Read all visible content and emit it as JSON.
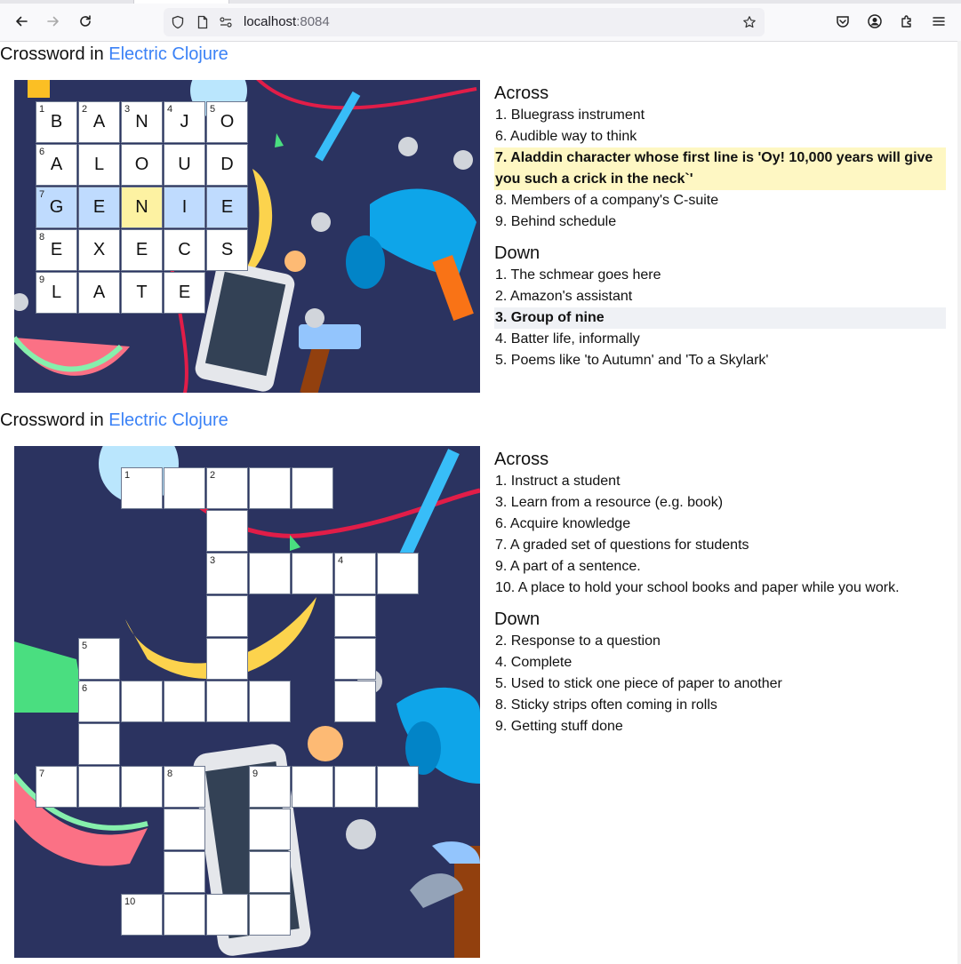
{
  "browser": {
    "url_host": "localhost",
    "url_port": ":8084"
  },
  "crossword1": {
    "title_prefix": "Crossword in ",
    "title_link": "Electric Clojure",
    "across_heading": "Across",
    "down_heading": "Down",
    "across": [
      {
        "text": "1. Bluegrass instrument",
        "state": ""
      },
      {
        "text": "6. Audible way to think",
        "state": ""
      },
      {
        "text": "7. Aladdin character whose first line is 'Oy! 10,000 years will give you such a crick in the neck`'",
        "state": "active"
      },
      {
        "text": "8. Members of a company's C-suite",
        "state": ""
      },
      {
        "text": "9. Behind schedule",
        "state": ""
      }
    ],
    "down": [
      {
        "text": "1. The schmear goes here",
        "state": ""
      },
      {
        "text": "2. Amazon's assistant",
        "state": ""
      },
      {
        "text": "3. Group of nine",
        "state": "secondary"
      },
      {
        "text": "4. Batter life, informally",
        "state": ""
      },
      {
        "text": "5. Poems like 'to Autumn' and 'To a Skylark'",
        "state": ""
      }
    ],
    "cells": [
      {
        "r": 0,
        "c": 0,
        "n": "1",
        "l": "B"
      },
      {
        "r": 0,
        "c": 1,
        "n": "2",
        "l": "A"
      },
      {
        "r": 0,
        "c": 2,
        "n": "3",
        "l": "N"
      },
      {
        "r": 0,
        "c": 3,
        "n": "4",
        "l": "J"
      },
      {
        "r": 0,
        "c": 4,
        "n": "5",
        "l": "O"
      },
      {
        "r": 1,
        "c": 0,
        "n": "6",
        "l": "A"
      },
      {
        "r": 1,
        "c": 1,
        "n": "",
        "l": "L"
      },
      {
        "r": 1,
        "c": 2,
        "n": "",
        "l": "O"
      },
      {
        "r": 1,
        "c": 3,
        "n": "",
        "l": "U"
      },
      {
        "r": 1,
        "c": 4,
        "n": "",
        "l": "D"
      },
      {
        "r": 2,
        "c": 0,
        "n": "7",
        "l": "G",
        "s": "hl"
      },
      {
        "r": 2,
        "c": 1,
        "n": "",
        "l": "E",
        "s": "hl"
      },
      {
        "r": 2,
        "c": 2,
        "n": "",
        "l": "N",
        "s": "cur"
      },
      {
        "r": 2,
        "c": 3,
        "n": "",
        "l": "I",
        "s": "hl"
      },
      {
        "r": 2,
        "c": 4,
        "n": "",
        "l": "E",
        "s": "hl"
      },
      {
        "r": 3,
        "c": 0,
        "n": "8",
        "l": "E"
      },
      {
        "r": 3,
        "c": 1,
        "n": "",
        "l": "X"
      },
      {
        "r": 3,
        "c": 2,
        "n": "",
        "l": "E"
      },
      {
        "r": 3,
        "c": 3,
        "n": "",
        "l": "C"
      },
      {
        "r": 3,
        "c": 4,
        "n": "",
        "l": "S"
      },
      {
        "r": 4,
        "c": 0,
        "n": "9",
        "l": "L"
      },
      {
        "r": 4,
        "c": 1,
        "n": "",
        "l": "A"
      },
      {
        "r": 4,
        "c": 2,
        "n": "",
        "l": "T"
      },
      {
        "r": 4,
        "c": 3,
        "n": "",
        "l": "E"
      }
    ]
  },
  "crossword2": {
    "title_prefix": "Crossword in ",
    "title_link": "Electric Clojure",
    "across_heading": "Across",
    "down_heading": "Down",
    "across": [
      {
        "text": "1. Instruct a student",
        "state": ""
      },
      {
        "text": "3. Learn from a resource (e.g. book)",
        "state": ""
      },
      {
        "text": "6. Acquire knowledge",
        "state": ""
      },
      {
        "text": "7. A graded set of questions for students",
        "state": ""
      },
      {
        "text": "9. A part of a sentence.",
        "state": ""
      },
      {
        "text": "10. A place to hold your school books and paper while you work.",
        "state": ""
      }
    ],
    "down": [
      {
        "text": "2. Response to a question",
        "state": ""
      },
      {
        "text": "4. Complete",
        "state": ""
      },
      {
        "text": "5. Used to stick one piece of paper to another",
        "state": ""
      },
      {
        "text": "8. Sticky strips often coming in rolls",
        "state": ""
      },
      {
        "text": "9. Getting stuff done",
        "state": ""
      }
    ],
    "cells": [
      {
        "r": 0,
        "c": 2,
        "n": "1"
      },
      {
        "r": 0,
        "c": 3,
        "n": ""
      },
      {
        "r": 0,
        "c": 4,
        "n": "2"
      },
      {
        "r": 0,
        "c": 5,
        "n": ""
      },
      {
        "r": 0,
        "c": 6,
        "n": ""
      },
      {
        "r": 1,
        "c": 4,
        "n": ""
      },
      {
        "r": 2,
        "c": 4,
        "n": "3"
      },
      {
        "r": 2,
        "c": 5,
        "n": ""
      },
      {
        "r": 2,
        "c": 6,
        "n": ""
      },
      {
        "r": 2,
        "c": 7,
        "n": "4"
      },
      {
        "r": 2,
        "c": 8,
        "n": ""
      },
      {
        "r": 3,
        "c": 4,
        "n": ""
      },
      {
        "r": 3,
        "c": 7,
        "n": ""
      },
      {
        "r": 4,
        "c": 1,
        "n": "5"
      },
      {
        "r": 4,
        "c": 4,
        "n": ""
      },
      {
        "r": 4,
        "c": 7,
        "n": ""
      },
      {
        "r": 5,
        "c": 1,
        "n": "6"
      },
      {
        "r": 5,
        "c": 2,
        "n": ""
      },
      {
        "r": 5,
        "c": 3,
        "n": ""
      },
      {
        "r": 5,
        "c": 4,
        "n": ""
      },
      {
        "r": 5,
        "c": 5,
        "n": ""
      },
      {
        "r": 5,
        "c": 7,
        "n": ""
      },
      {
        "r": 6,
        "c": 1,
        "n": ""
      },
      {
        "r": 7,
        "c": 0,
        "n": "7"
      },
      {
        "r": 7,
        "c": 1,
        "n": ""
      },
      {
        "r": 7,
        "c": 2,
        "n": ""
      },
      {
        "r": 7,
        "c": 3,
        "n": "8"
      },
      {
        "r": 7,
        "c": 5,
        "n": "9"
      },
      {
        "r": 7,
        "c": 6,
        "n": ""
      },
      {
        "r": 7,
        "c": 7,
        "n": ""
      },
      {
        "r": 7,
        "c": 8,
        "n": ""
      },
      {
        "r": 8,
        "c": 3,
        "n": ""
      },
      {
        "r": 8,
        "c": 5,
        "n": ""
      },
      {
        "r": 9,
        "c": 3,
        "n": ""
      },
      {
        "r": 9,
        "c": 5,
        "n": ""
      },
      {
        "r": 10,
        "c": 2,
        "n": "10"
      },
      {
        "r": 10,
        "c": 3,
        "n": ""
      },
      {
        "r": 10,
        "c": 4,
        "n": ""
      },
      {
        "r": 10,
        "c": 5,
        "n": ""
      }
    ]
  }
}
